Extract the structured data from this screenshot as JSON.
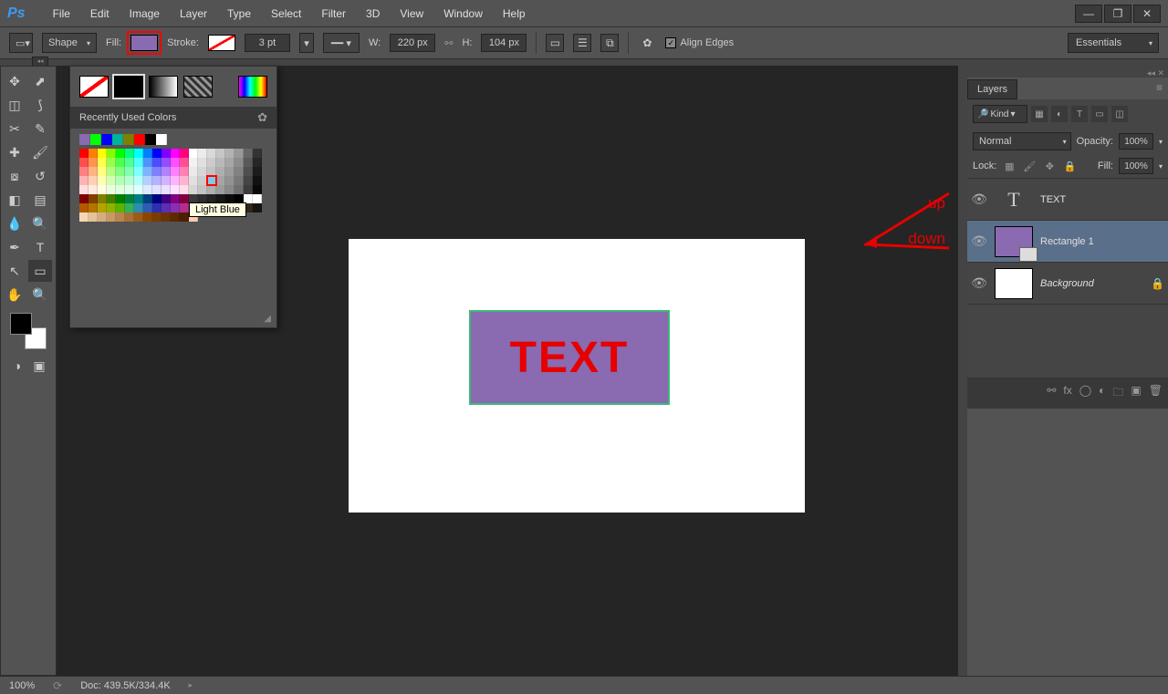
{
  "menu": [
    "File",
    "Edit",
    "Image",
    "Layer",
    "Type",
    "Select",
    "Filter",
    "3D",
    "View",
    "Window",
    "Help"
  ],
  "options": {
    "mode": "Shape",
    "fill_label": "Fill:",
    "stroke_label": "Stroke:",
    "stroke_size": "3 pt",
    "w_label": "W:",
    "w_value": "220 px",
    "h_label": "H:",
    "h_value": "104 px",
    "align_edges": "Align Edges"
  },
  "workspace": "Essentials",
  "color_panel": {
    "recent_label": "Recently Used Colors",
    "tooltip": "Light Blue"
  },
  "canvas_text": "TEXT",
  "annotations": {
    "up": "up",
    "down": "down"
  },
  "layers": {
    "title": "Layers",
    "filter": "Kind",
    "blend": "Normal",
    "opacity_label": "Opacity:",
    "opacity": "100%",
    "lock_label": "Lock:",
    "fill_label": "Fill:",
    "fill": "100%",
    "items": [
      {
        "name": "TEXT",
        "type": "text"
      },
      {
        "name": "Rectangle 1",
        "type": "shape",
        "selected": true
      },
      {
        "name": "Background",
        "type": "bg",
        "locked": true
      }
    ]
  },
  "status": {
    "zoom": "100%",
    "doc": "Doc: 439.5K/334.4K"
  }
}
